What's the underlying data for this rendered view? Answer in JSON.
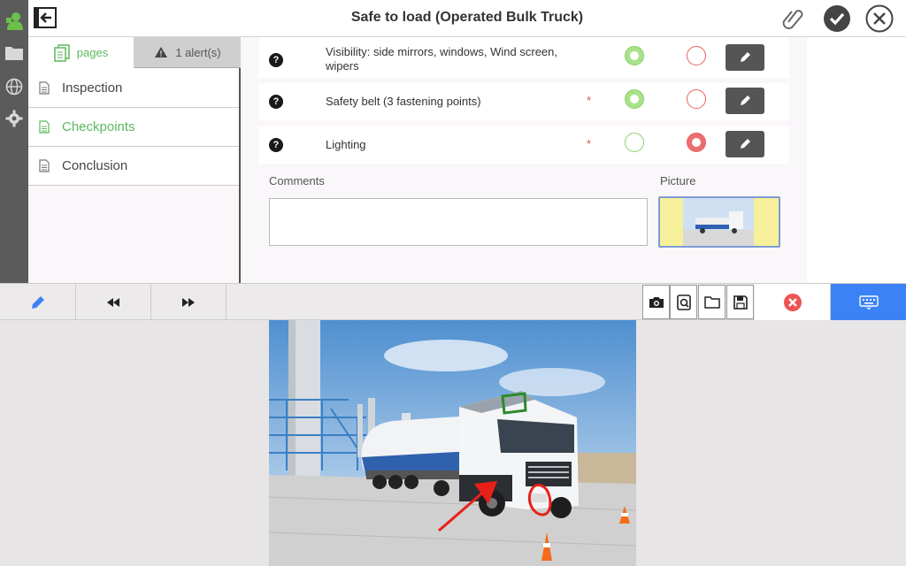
{
  "header": {
    "title": "Safe to load (Operated Bulk Truck)"
  },
  "tabs": {
    "pages_label": "pages",
    "alerts_label": "1 alert(s)"
  },
  "nav": [
    {
      "label": "Inspection",
      "active": false
    },
    {
      "label": "Checkpoints",
      "active": true
    },
    {
      "label": "Conclusion",
      "active": false
    }
  ],
  "checkpoints": [
    {
      "text": "Visibility: side mirrors, windows, Wind screen, wipers",
      "required": false,
      "ok": true,
      "nok": false
    },
    {
      "text": "Safety belt (3 fastening points)",
      "required": true,
      "ok": true,
      "nok": false
    },
    {
      "text": "Lighting",
      "required": true,
      "ok": false,
      "nok": true
    }
  ],
  "required_marker": "*",
  "help_glyph": "?",
  "comments": {
    "label": "Comments",
    "value": ""
  },
  "picture": {
    "label": "Picture"
  },
  "colors": {
    "accent_green": "#5cb85c",
    "danger_red": "#e66060",
    "keyboard_blue": "#3b82f6",
    "dark_button": "#555555"
  },
  "toolbar_icons": [
    "pencil-icon",
    "rewind-icon",
    "fast-forward-icon",
    "camera-icon",
    "scan-icon",
    "folder-icon",
    "save-icon",
    "cancel-icon",
    "keyboard-icon"
  ]
}
